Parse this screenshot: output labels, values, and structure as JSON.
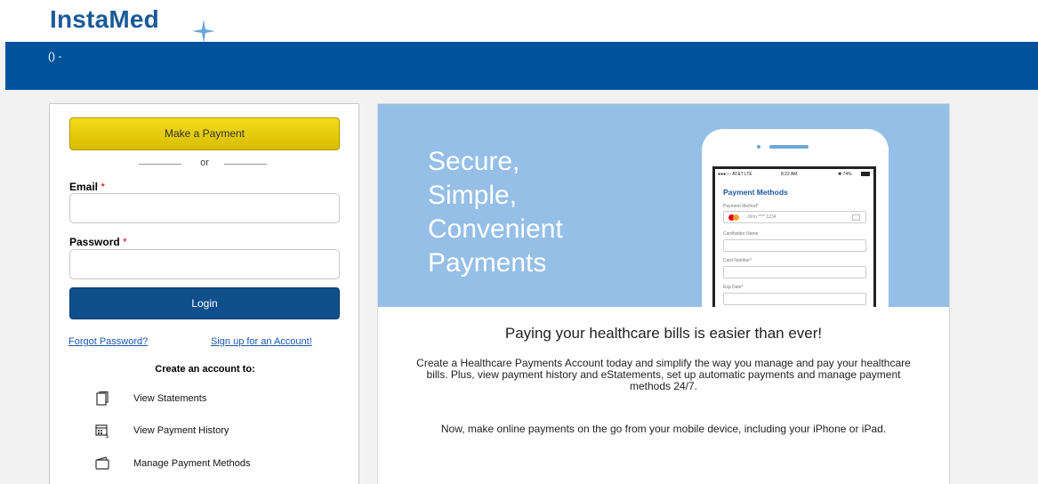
{
  "brand": {
    "logo_text": "InstaMed",
    "accent": "#00539b"
  },
  "header": {
    "bar_text": "() -"
  },
  "login": {
    "make_payment_label": "Make a Payment",
    "or_text": "or",
    "email_label": "Email",
    "email_value": "",
    "password_label": "Password",
    "password_value": "",
    "required_marker": "*",
    "login_label": "Login",
    "forgot_password": "Forgot Password?",
    "signup": "Sign up for an Account!",
    "create_title": "Create an account to:",
    "benefits": [
      {
        "label": "View Statements",
        "icon": "statements-icon"
      },
      {
        "label": "View Payment History",
        "icon": "payment-history-icon"
      },
      {
        "label": "Manage Payment Methods",
        "icon": "wallet-icon"
      }
    ]
  },
  "promo": {
    "hero_lines": [
      "Secure,",
      "Simple,",
      "Convenient",
      "Payments"
    ],
    "phone": {
      "carrier": "●●●○○ AT&T  LTE",
      "time": "8:22 AM",
      "battery": "✱ 74%",
      "title": "Payment Methods",
      "payment_method_label": "Payment Method*",
      "card_text": "John **** 1234",
      "cardholder_label": "Cardholder Name",
      "card_number_label": "Card Number*",
      "exp_label": "Exp Date*"
    },
    "tagline": "Paying your healthcare bills is easier than ever!",
    "description_1": "Create a Healthcare Payments Account today and simplify the way you manage and pay your healthcare bills. Plus, view payment history and eStatements, set up automatic payments and manage payment methods 24/7.",
    "description_2": "Now, make online payments on the go from your mobile device, including your iPhone or iPad."
  }
}
